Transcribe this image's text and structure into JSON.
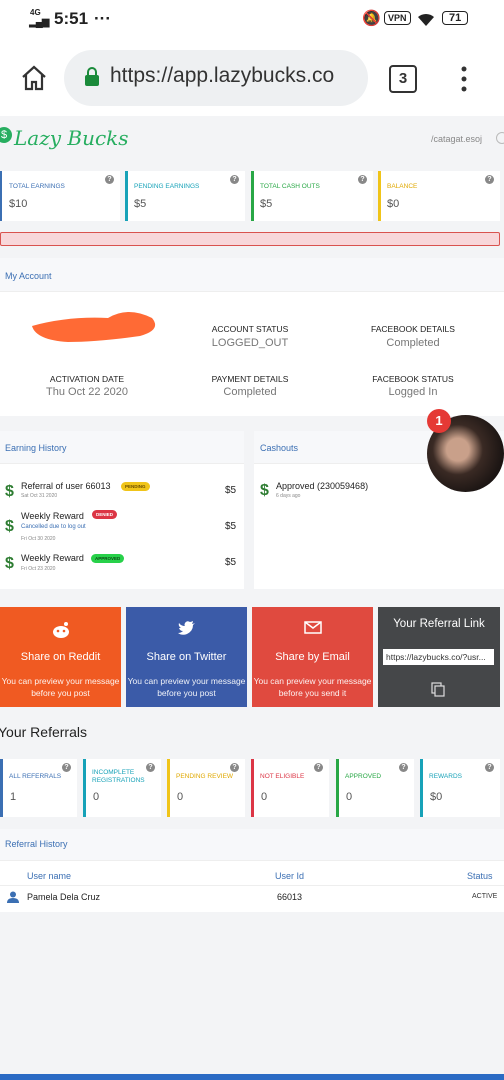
{
  "status_bar": {
    "network": "4G",
    "time": "5:51",
    "dots": "···",
    "vpn": "VPN",
    "battery": "71"
  },
  "browser": {
    "url": "https://app.lazybucks.co",
    "tab_count": "3"
  },
  "header": {
    "brand": "Lazy Bucks",
    "user_link": "/catagat.esoj"
  },
  "stats": [
    {
      "label": "Total Earnings",
      "value": "$10",
      "color": "#3b6fb3"
    },
    {
      "label": "Pending Earnings",
      "value": "$5",
      "color": "#17a2b8"
    },
    {
      "label": "Total Cash Outs",
      "value": "$5",
      "color": "#28a745"
    },
    {
      "label": "Balance",
      "value": "$0",
      "color": "#f0c419"
    }
  ],
  "account": {
    "title": "My Account",
    "status_label": "Account Status",
    "status_value": "LOGGED_OUT",
    "fb_details_label": "Facebook Details",
    "fb_details_value": "Completed",
    "activation_label": "Activation Date",
    "activation_value": "Thu Oct 22 2020",
    "payment_label": "Payment Details",
    "payment_value": "Completed",
    "fb_status_label": "Facebook Status",
    "fb_status_value": "Logged In"
  },
  "earning_history": {
    "title": "Earning History",
    "items": [
      {
        "title": "Referral of user 66013",
        "badge": "Pending",
        "date": "Sat Oct 31 2020",
        "amount": "$5"
      },
      {
        "title": "Weekly Reward",
        "badge": "Denied",
        "note": "Cancelled due to log out",
        "date": "Fri Oct 30 2020",
        "amount": "$5"
      },
      {
        "title": "Weekly Reward",
        "badge": "Approved",
        "date": "Fri Oct 23 2020",
        "amount": "$5"
      }
    ]
  },
  "cashouts": {
    "title": "Cashouts",
    "items": [
      {
        "title": "Approved (230059468)",
        "date": "6 days ago"
      }
    ],
    "notification_count": "1"
  },
  "share": {
    "reddit": {
      "title": "Share on Reddit",
      "sub": "You can preview your message before you post",
      "color": "#f05a22"
    },
    "twitter": {
      "title": "Share on Twitter",
      "sub": "You can preview your message before you post",
      "color": "#3b5ba8"
    },
    "email": {
      "title": "Share by Email",
      "sub": "You can preview your message before you send it",
      "color": "#e04a3f"
    },
    "link": {
      "title": "Your Referral Link",
      "url": "https://lazybucks.co/?usr...",
      "color": "#454749"
    }
  },
  "referrals": {
    "title": "Your Referrals",
    "boxes": [
      {
        "label": "All Referrals",
        "value": "1",
        "color": "#3b6fb3"
      },
      {
        "label": "Incomplete Registrations",
        "value": "0",
        "color": "#17a2b8"
      },
      {
        "label": "Pending Review",
        "value": "0",
        "color": "#f0c419"
      },
      {
        "label": "Not Eligible",
        "value": "0",
        "color": "#dc3545"
      },
      {
        "label": "Approved",
        "value": "0",
        "color": "#28a745"
      },
      {
        "label": "Rewards",
        "value": "$0",
        "color": "#17a2b8"
      }
    ]
  },
  "referral_history": {
    "title": "Referral History",
    "col_user": "User name",
    "col_id": "User Id",
    "col_status": "Status",
    "rows": [
      {
        "user": "Pamela Dela Cruz",
        "id": "66013",
        "status": "ACTIVE"
      }
    ]
  }
}
